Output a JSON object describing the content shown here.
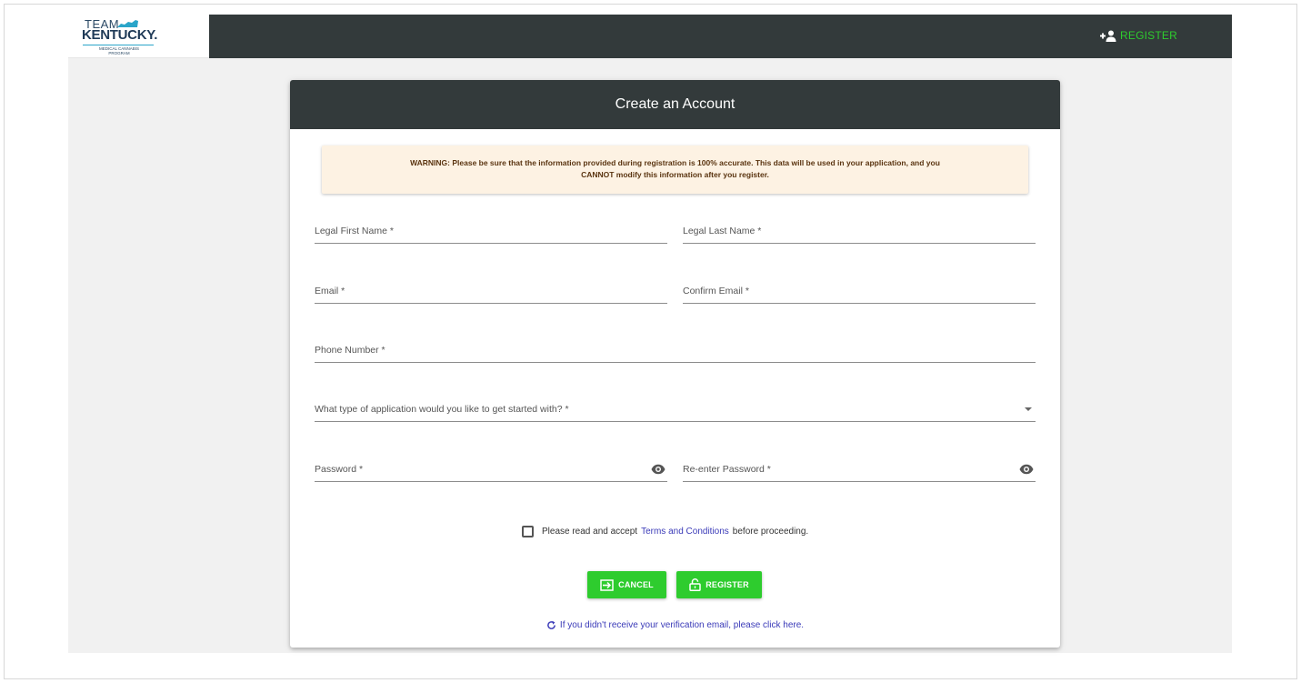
{
  "header": {
    "logo": {
      "team": "TEAM",
      "kentucky": "KENTUCKY.",
      "subtitle_line1": "MEDICAL CANNABIS",
      "subtitle_line2": "PROGRAM"
    },
    "register_label": "REGISTER"
  },
  "card": {
    "title": "Create an Account",
    "warning_line1": "WARNING: Please be sure that the information provided during registration is 100% accurate. This data will be used in your application, and you",
    "warning_line2": "CANNOT modify this information after you register."
  },
  "form": {
    "first_name_label": "Legal First Name *",
    "last_name_label": "Legal Last Name *",
    "email_label": "Email *",
    "confirm_email_label": "Confirm Email *",
    "phone_label": "Phone Number *",
    "application_type_label": "What type of application would you like to get started with? *",
    "password_label": "Password *",
    "reenter_password_label": "Re-enter Password *"
  },
  "terms": {
    "prefix": "Please read and accept",
    "link": "Terms and Conditions",
    "suffix": "before proceeding."
  },
  "buttons": {
    "cancel_label": "CANCEL",
    "register_label": "REGISTER"
  },
  "resend_link": "If you didn't receive your verification email, please click here.",
  "colors": {
    "dark_header": "#333a3b",
    "accent_green": "#2ecc2e",
    "warning_bg": "#fdf2e3",
    "link_blue": "#3a3ab8",
    "app_bg": "#f1f1f1"
  }
}
